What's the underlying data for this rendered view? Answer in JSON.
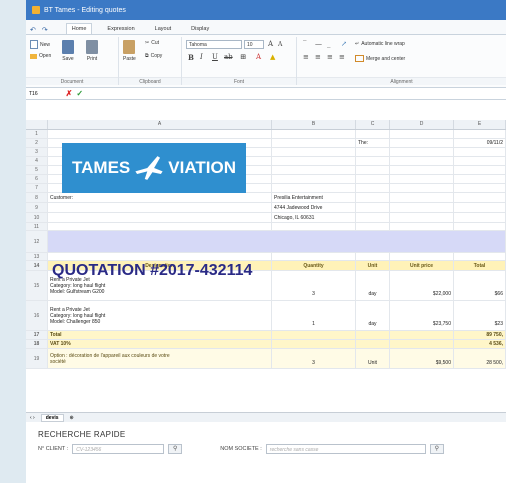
{
  "window": {
    "title": "BT Tames - Editing quotes"
  },
  "tabs": [
    "Home",
    "Expression",
    "Layout",
    "Display"
  ],
  "ribbon": {
    "document": {
      "label": "Document",
      "new": "New",
      "open": "Open",
      "save": "Save",
      "print": "Print"
    },
    "clipboard": {
      "label": "Clipboard",
      "cut": "Cut",
      "paste": "Paste",
      "copy": "Copy"
    },
    "font": {
      "label": "Font",
      "name": "Tahoma",
      "size": "10"
    },
    "alignment": {
      "label": "Alignment",
      "wrap": "Automatic line wrap",
      "merge": "Merge and center"
    }
  },
  "formula": {
    "cell": "T16"
  },
  "columns": [
    "A",
    "B",
    "C",
    "D",
    "E"
  ],
  "logo": {
    "left": "TAMES",
    "right": "VIATION"
  },
  "sheet": {
    "the_label": "The:",
    "date": "09/11/2",
    "customer_label": "Customer:",
    "customer_name": "Presilia Entertainment",
    "address1": "4744 Jadewood Drive",
    "address2": "Chicago, IL 60631",
    "quote_title": "QUOTATION #2017-432114",
    "headers": [
      "Designation",
      "Quantity",
      "Unit",
      "Unit price",
      "Total"
    ],
    "items": [
      {
        "lines": [
          "Rent a Private Jet",
          "Category: long haul flight",
          "Model: Gulfstream G200"
        ],
        "qty": "3",
        "unit": "day",
        "price": "$22,000",
        "total": "$66"
      },
      {
        "lines": [
          "Rent a Private Jet",
          "Category: long haul flight",
          "Model: Challenger 850"
        ],
        "qty": "1",
        "unit": "day",
        "price": "$23,750",
        "total": "$23"
      }
    ],
    "total_label": "Total",
    "total_value": "89 750,",
    "vat_label": "VAT 10%",
    "vat_value": "4 536,",
    "option_lines": [
      "Option : décoration de l'appareil aux couleurs de votre",
      "société"
    ],
    "option_qty": "3",
    "option_unit": "Unit",
    "option_price": "$9,500",
    "option_total": "28 500,"
  },
  "row_numbers": [
    "1",
    "2",
    "3",
    "4",
    "5",
    "6",
    "7",
    "8",
    "9",
    "10",
    "11",
    "12",
    "13",
    "14",
    "15",
    "16",
    "17",
    "18",
    "19"
  ],
  "sheet_tab": "devis",
  "search": {
    "title": "RECHERCHE RAPIDE",
    "client_label": "N° CLIENT :",
    "client_placeholder": "CV-123456",
    "company_label": "NOM SOCIETE :",
    "company_placeholder": "recherche sans casse"
  },
  "colors": {
    "titlebar": "#3b79c5",
    "quote_band": "#d6d9f7",
    "header_band": "#fff2b8",
    "logo_bg": "#2f8fcf"
  }
}
